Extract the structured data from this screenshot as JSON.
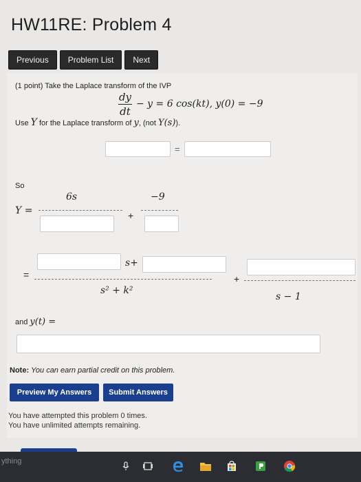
{
  "title": "HW11RE: Problem 4",
  "nav": {
    "previous": "Previous",
    "list": "Problem List",
    "next": "Next"
  },
  "problem": {
    "head": "(1 point) Take the Laplace transform of the IVP",
    "eq_num": "dy",
    "eq_den": "dt",
    "eq_rest": "− y = 6 cos(kt), y(0) = −9",
    "use_pre": "Use",
    "use_Y": "Y",
    "use_mid": "for the Laplace transform of",
    "use_y": "y",
    "use_post": ", (not",
    "use_Ys": "Y(s)",
    "use_end": ")."
  },
  "so_label": "So",
  "eq_sign": "=",
  "Y_eq": "Y =",
  "num_6s": "6s",
  "num_m9": "−9",
  "plus": "+",
  "eq2": "=",
  "s_plus": "s+",
  "den_s2k2": "s² + k²",
  "den_s1": "s − 1",
  "and_label": "and",
  "and_yt": "y(t) =",
  "note": {
    "bold": "Note:",
    "text": "You can earn partial credit on this problem."
  },
  "buttons": {
    "preview": "Preview My Answers",
    "submit": "Submit Answers"
  },
  "messages": {
    "attempted": "You have attempted this problem 0 times.",
    "remaining": "You have unlimited attempts remaining."
  },
  "taskbar": {
    "search": "ything",
    "icons": [
      "mic-icon",
      "task-view-icon",
      "edge-icon",
      "file-explorer-icon",
      "store-icon",
      "app-icon",
      "chrome-icon"
    ]
  }
}
